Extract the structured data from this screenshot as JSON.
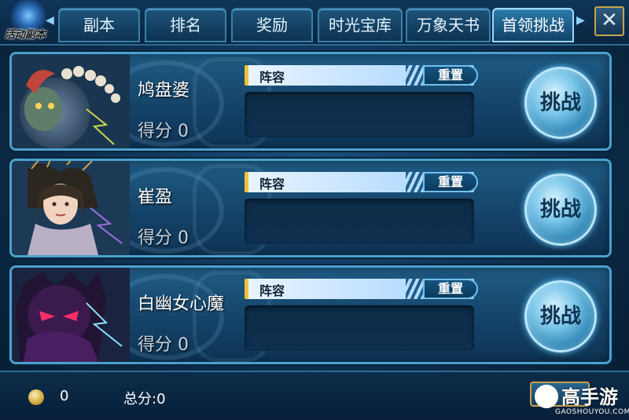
{
  "header": {
    "badge_label": "活动副本",
    "tabs": [
      {
        "label": "副本"
      },
      {
        "label": "排名"
      },
      {
        "label": "奖励"
      },
      {
        "label": "时光宝库"
      },
      {
        "label": "万象天书"
      },
      {
        "label": "首领挑战",
        "active": true
      }
    ],
    "close_icon": "close-x-icon"
  },
  "bosses": [
    {
      "name": "鸠盘婆",
      "score_label": "得分 0",
      "lineup_label": "阵容",
      "reset_label": "重置",
      "challenge_label": "挑战",
      "portrait": "skull-demon"
    },
    {
      "name": "崔盈",
      "score_label": "得分 0",
      "lineup_label": "阵容",
      "reset_label": "重置",
      "challenge_label": "挑战",
      "portrait": "crowned-woman"
    },
    {
      "name": "白幽女心魔",
      "score_label": "得分 0",
      "lineup_label": "阵容",
      "reset_label": "重置",
      "challenge_label": "挑战",
      "portrait": "shadow-demon"
    }
  ],
  "footer": {
    "coin_count": "0",
    "total_score": "总分:0"
  },
  "watermark": {
    "brand": "高手游",
    "domain": "GAOSHOUYOU.COM"
  },
  "colors": {
    "accent_gold": "#f0c23a",
    "frame_blue": "#4aa1cf",
    "background": "#0d2e4d"
  }
}
